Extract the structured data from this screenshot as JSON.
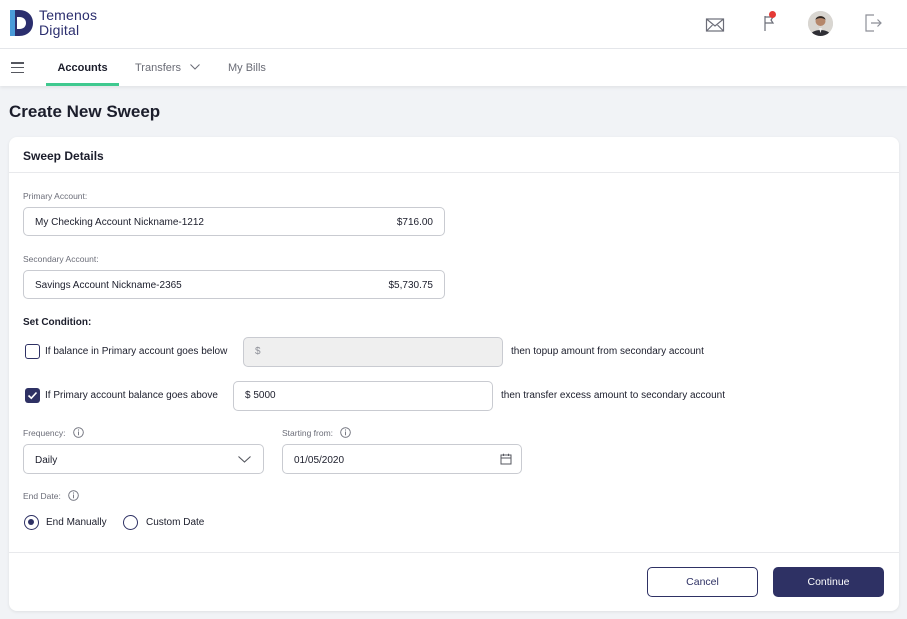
{
  "brand": {
    "line1": "Temenos",
    "line2": "Digital",
    "color": "#2b2e6e"
  },
  "header": {
    "icons": [
      "mail-icon",
      "flag-icon",
      "avatar",
      "logout-icon"
    ]
  },
  "nav": {
    "tabs": [
      {
        "label": "Accounts",
        "active": true
      },
      {
        "label": "Transfers",
        "has_dropdown": true
      },
      {
        "label": "My Bills"
      }
    ],
    "accent": "#3fc98f"
  },
  "page": {
    "title": "Create New Sweep"
  },
  "card": {
    "title": "Sweep Details",
    "primary": {
      "label": "Primary Account:",
      "name": "My Checking Account Nickname-1212",
      "amount": "$716.00"
    },
    "secondary": {
      "label": "Secondary Account:",
      "name": "Savings Account Nickname-2365",
      "amount": "$5,730.75"
    },
    "condition": {
      "label": "Set Condition:",
      "below": {
        "checked": false,
        "text": "If balance in Primary account goes below",
        "placeholder": "$",
        "suffix": "then topup amount from secondary account"
      },
      "above": {
        "checked": true,
        "text": "If Primary account balance goes above",
        "value": "$ 5000",
        "suffix": "then transfer excess amount to secondary account"
      }
    },
    "frequency": {
      "label": "Frequency:",
      "value": "Daily"
    },
    "starting": {
      "label": "Starting from:",
      "value": "01/05/2020"
    },
    "end_date": {
      "label": "End Date:",
      "options": [
        {
          "label": "End Manually",
          "selected": true
        },
        {
          "label": "Custom Date",
          "selected": false
        }
      ]
    },
    "buttons": {
      "cancel": "Cancel",
      "continue": "Continue"
    }
  },
  "colors": {
    "primary": "#2e3164",
    "page_bg": "#f1f3f6"
  }
}
